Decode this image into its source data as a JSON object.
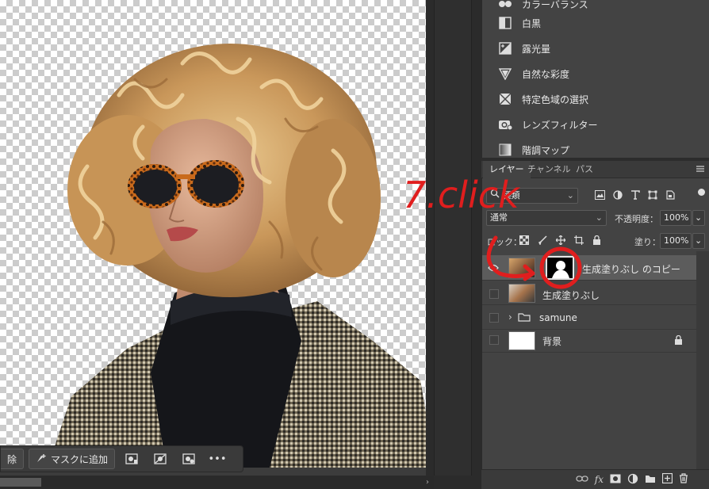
{
  "adjustments": [
    {
      "label": "カラーバランス",
      "icon": "color-balance-icon"
    },
    {
      "label": "白黒",
      "icon": "black-white-icon"
    },
    {
      "label": "露光量",
      "icon": "exposure-icon"
    },
    {
      "label": "自然な彩度",
      "icon": "vibrance-icon"
    },
    {
      "label": "特定色域の選択",
      "icon": "selective-color-icon"
    },
    {
      "label": "レンズフィルター",
      "icon": "photo-filter-icon"
    },
    {
      "label": "階調マップ",
      "icon": "gradient-map-icon"
    }
  ],
  "tabs": [
    {
      "label": "レイヤー"
    },
    {
      "label": "チャンネル"
    },
    {
      "label": "パス"
    }
  ],
  "filter": {
    "label": "種類"
  },
  "blend": {
    "mode": "通常",
    "opacity_label": "不透明度：",
    "opacity_value": "100%"
  },
  "lock": {
    "label": "ロック：",
    "fill_label": "塗り：",
    "fill_value": "100%"
  },
  "layers": [
    {
      "name": "生成塗りぶし のコピー",
      "visible": true,
      "selected": true
    },
    {
      "name": "生成塗りぶし",
      "visible": false,
      "selected": false
    },
    {
      "name": "samune",
      "visible": false,
      "selected": false
    },
    {
      "name": "背景",
      "visible": false,
      "selected": false
    }
  ],
  "taskbar": {
    "remove_label": "除",
    "add_mask_label": "マスクに追加",
    "more_label": "•••"
  },
  "annotation": {
    "text": "7.click",
    "color": "#e01e1e"
  },
  "colors": {
    "panel": "#434343",
    "selected_layer": "#5c5c5c",
    "accent": "#e01e1e"
  }
}
